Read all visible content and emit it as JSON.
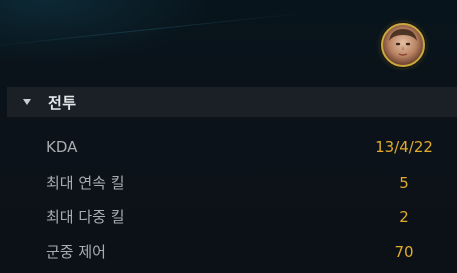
{
  "section": {
    "title": "전투",
    "expanded": true,
    "caret_icon": "caret-down-icon"
  },
  "profile": {
    "avatar_icon": "champion-portrait",
    "ring_color": "#c9a93d"
  },
  "stats": [
    {
      "label": "KDA",
      "value": "13/4/22"
    },
    {
      "label": "최대 연속 킬",
      "value": "5"
    },
    {
      "label": "최대 다중 킬",
      "value": "2"
    },
    {
      "label": "군중 제어",
      "value": "70"
    }
  ],
  "colors": {
    "label": "#a9acb0",
    "value": "#e1ac2c",
    "header_bg": "#1a2026",
    "header_text": "#e4e7ea"
  }
}
